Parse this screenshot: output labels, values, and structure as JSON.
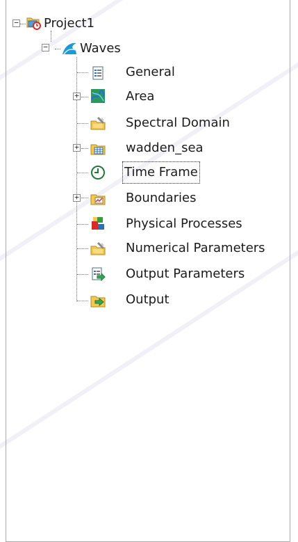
{
  "tree": {
    "root": {
      "label": "Project1",
      "icon": "project-icon",
      "expanded": true
    },
    "waves": {
      "label": "Waves",
      "icon": "waves-icon",
      "expanded": true
    },
    "children": [
      {
        "label": "General",
        "icon": "general-icon",
        "expandable": false
      },
      {
        "label": "Area",
        "icon": "area-icon",
        "expandable": true
      },
      {
        "label": "Spectral Domain",
        "icon": "spectral-domain-icon",
        "expandable": false
      },
      {
        "label": "wadden_sea",
        "icon": "grid-icon",
        "expandable": true
      },
      {
        "label": "Time Frame",
        "icon": "clock-icon",
        "expandable": false,
        "selected": true
      },
      {
        "label": "Boundaries",
        "icon": "boundaries-icon",
        "expandable": true
      },
      {
        "label": "Physical Processes",
        "icon": "physical-processes-icon",
        "expandable": false
      },
      {
        "label": "Numerical Parameters",
        "icon": "numerical-parameters-icon",
        "expandable": false
      },
      {
        "label": "Output Parameters",
        "icon": "output-parameters-icon",
        "expandable": false
      },
      {
        "label": "Output",
        "icon": "output-icon",
        "expandable": false
      }
    ],
    "expander_expanded_glyph": "−",
    "expander_collapsed_glyph": "+"
  },
  "colors": {
    "selection_outline": "#222222",
    "tree_line": "#777777",
    "panel_border": "#a9a9a9"
  }
}
